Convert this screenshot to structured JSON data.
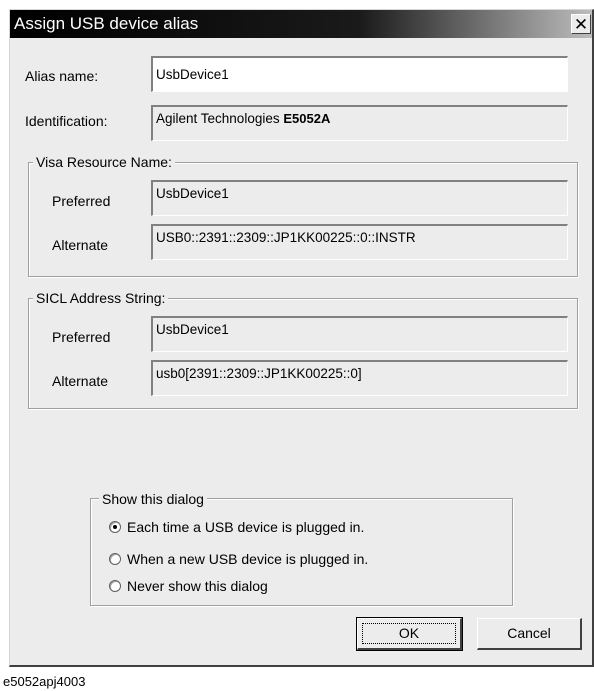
{
  "window": {
    "title": "Assign USB device alias",
    "close_glyph": "✕"
  },
  "alias": {
    "label": "Alias name:",
    "value": "UsbDevice1"
  },
  "identification": {
    "label": "Identification:",
    "vendor": "Agilent Technologies",
    "model": "E5052A"
  },
  "visa": {
    "group_label": "Visa Resource Name:",
    "preferred_label": "Preferred",
    "preferred_value": "UsbDevice1",
    "alternate_label": "Alternate",
    "alternate_value": "USB0::2391::2309::JP1KK00225::0::INSTR"
  },
  "sicl": {
    "group_label": "SICL Address String:",
    "preferred_label": "Preferred",
    "preferred_value": "UsbDevice1",
    "alternate_label": "Alternate",
    "alternate_value": "usb0[2391::2309::JP1KK00225::0]"
  },
  "show_dialog": {
    "group_label": "Show this dialog",
    "options": [
      {
        "label": "Each time a USB device is plugged in.",
        "checked": true
      },
      {
        "label": "When a new USB device is plugged in.",
        "checked": false
      },
      {
        "label": "Never show this dialog",
        "checked": false
      }
    ]
  },
  "buttons": {
    "ok": "OK",
    "cancel": "Cancel"
  },
  "caption": "e5052apj4003"
}
